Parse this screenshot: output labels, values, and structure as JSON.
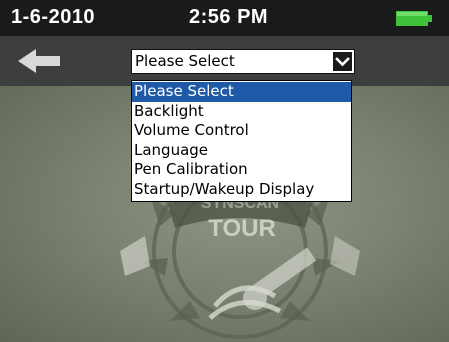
{
  "status_bar": {
    "date": "1-6-2010",
    "time": "2:56 PM",
    "battery_icon": "battery-full-icon",
    "battery_color": "#3fc23a"
  },
  "toolbar": {
    "back_icon": "back-arrow-icon",
    "select": {
      "value": "Please Select",
      "arrow_icon": "chevron-down-icon"
    }
  },
  "dropdown": {
    "options": [
      "Please Select",
      "Backlight",
      "Volume Control",
      "Language",
      "Pen Calibration",
      "Startup/Wakeup Display"
    ],
    "selected_index": 0,
    "highlight_color": "#1f5aa8"
  },
  "background_art": {
    "logo_text": "SYNSCAN TOUR",
    "logo_icon": "synscan-tour-logo"
  }
}
